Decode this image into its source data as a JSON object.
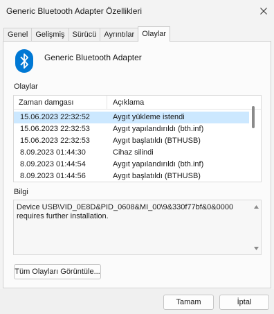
{
  "window": {
    "title": "Generic Bluetooth Adapter Özellikleri"
  },
  "tabs": [
    {
      "label": "Genel"
    },
    {
      "label": "Gelişmiş"
    },
    {
      "label": "Sürücü"
    },
    {
      "label": "Ayrıntılar"
    },
    {
      "label": "Olaylar"
    }
  ],
  "active_tab": "Olaylar",
  "device": {
    "name": "Generic Bluetooth Adapter",
    "icon": "bluetooth-icon",
    "icon_color": "#0078d4"
  },
  "events": {
    "section_label": "Olaylar",
    "columns": [
      "Zaman damgası",
      "Açıklama"
    ],
    "rows": [
      {
        "time": "15.06.2023 22:32:52",
        "desc": "Aygıt yükleme istendi",
        "selected": true
      },
      {
        "time": "15.06.2023 22:32:53",
        "desc": "Aygıt yapılandırıldı (bth.inf)"
      },
      {
        "time": "15.06.2023 22:32:53",
        "desc": "Aygıt başlatıldı (BTHUSB)"
      },
      {
        "time": "8.09.2023 01:44:30",
        "desc": "Cihaz silindi"
      },
      {
        "time": "8.09.2023 01:44:54",
        "desc": "Aygıt yapılandırıldı (bth.inf)"
      },
      {
        "time": "8.09.2023 01:44:56",
        "desc": "Aygıt başlatıldı (BTHUSB)"
      }
    ]
  },
  "info": {
    "section_label": "Bilgi",
    "text_line1": "Device USB\\VID_0E8D&PID_0608&MI_00\\9&330f77bf&0&0000",
    "text_line2": "requires further installation."
  },
  "buttons": {
    "view_all": "Tüm Olayları Görüntüle...",
    "ok": "Tamam",
    "cancel": "İptal"
  },
  "colors": {
    "selection": "#cce8ff",
    "accent": "#0078d4"
  }
}
